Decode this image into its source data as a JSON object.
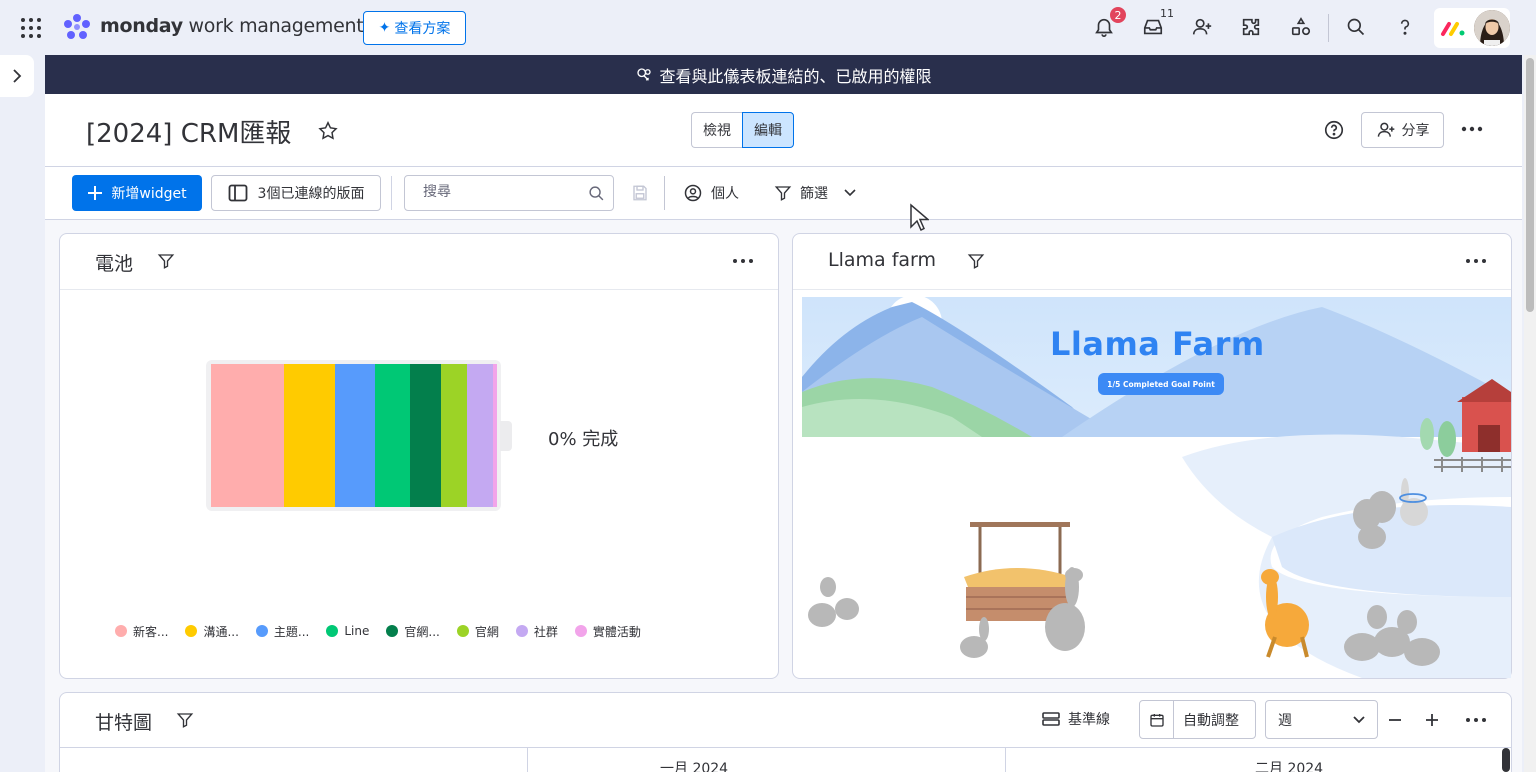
{
  "topbar": {
    "brand_bold": "monday",
    "brand_rest": " work management",
    "plan_button": "查看方案",
    "notifications_count": "2",
    "inbox_count": "11"
  },
  "banner": {
    "text": "查看與此儀表板連結的、已啟用的權限"
  },
  "header": {
    "title": "[2024] CRM匯報",
    "view_label": "檢視",
    "edit_label": "編輯",
    "share_label": "分享"
  },
  "toolbar": {
    "add_widget": "新增widget",
    "connected_boards": "3個已連線的版面",
    "search_placeholder": "搜尋",
    "person_label": "個人",
    "filter_label": "篩選"
  },
  "battery_widget": {
    "title": "電池",
    "progress_text": "0% 完成",
    "segments": [
      {
        "label": "新客...",
        "color": "#ffadad",
        "share": 0.255
      },
      {
        "label": "溝通...",
        "color": "#ffcb00",
        "share": 0.18
      },
      {
        "label": "主題...",
        "color": "#579bfc",
        "share": 0.14
      },
      {
        "label": "Line",
        "color": "#00c875",
        "share": 0.12
      },
      {
        "label": "官網...",
        "color": "#037f4c",
        "share": 0.11
      },
      {
        "label": "官網",
        "color": "#9cd326",
        "share": 0.09
      },
      {
        "label": "社群",
        "color": "#c4a9f2",
        "share": 0.09
      },
      {
        "label": "實體活動",
        "color": "#f2a4ea",
        "share": 0.015
      }
    ]
  },
  "llama_widget": {
    "title": "Llama farm",
    "game_title": "Llama Farm",
    "goal_text": "1/5 Completed Goal Point"
  },
  "gantt_widget": {
    "title": "甘特圖",
    "baseline_label": "基準線",
    "auto_fit_label": "自動調整",
    "scale_value": "週",
    "month_1": "一月 2024",
    "month_2": "二月 2024"
  }
}
